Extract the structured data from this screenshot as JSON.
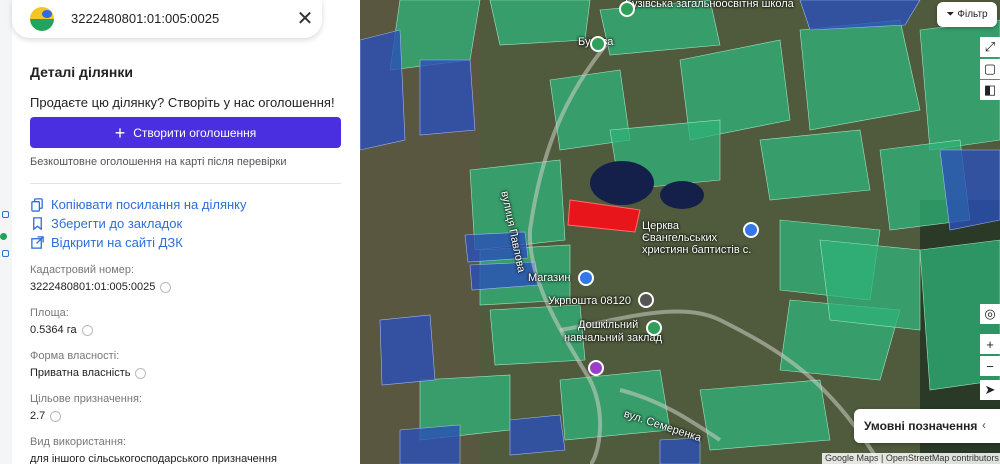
{
  "search": {
    "value": "3222480801:01:005:0025"
  },
  "details": {
    "title": "Деталі ділянки",
    "sell_prompt": "Продаєте цю ділянку? Створіть у нас оголошення!",
    "create_button": "Створити оголошення",
    "free_note": "Безкоштовне оголошення на карті після перевірки"
  },
  "actions": {
    "copy_link": "Копіювати посилання на ділянку",
    "save_bookmark": "Зберегти до закладок",
    "open_dzk": "Відкрити на сайті ДЗК"
  },
  "fields": [
    {
      "label": "Кадастровий номер:",
      "value": "3222480801:01:005:0025"
    },
    {
      "label": "Площа:",
      "value": "0.5364 га"
    },
    {
      "label": "Форма власності:",
      "value": "Приватна власність"
    },
    {
      "label": "Цільове призначення:",
      "value": "2.7"
    },
    {
      "label": "Вид використання:",
      "value": "для іншого сільськогосподарського призначення"
    }
  ],
  "map": {
    "labels": {
      "school": "Бузівська загальноосвітня школа",
      "buzova": "Бузова",
      "church": "Церква Євангельських християн баптистів с.",
      "street_pavlova": "вулиця Павлова",
      "shop": "Магазин",
      "post": "Укрпошта 08120",
      "kindergarten_1": "Дошкільний",
      "kindergarten_2": "навчальний заклад",
      "street_semerenka": "вул. Семеренка"
    },
    "filter_button": "Фільтр",
    "legend_button": "Умовні позначення",
    "attribution": "Google Maps | OpenStreetMap contributors",
    "colors": {
      "selected_parcel": "#e8161b",
      "parcel_green": "#2fb37a",
      "parcel_blue": "#2b4fb8"
    }
  }
}
